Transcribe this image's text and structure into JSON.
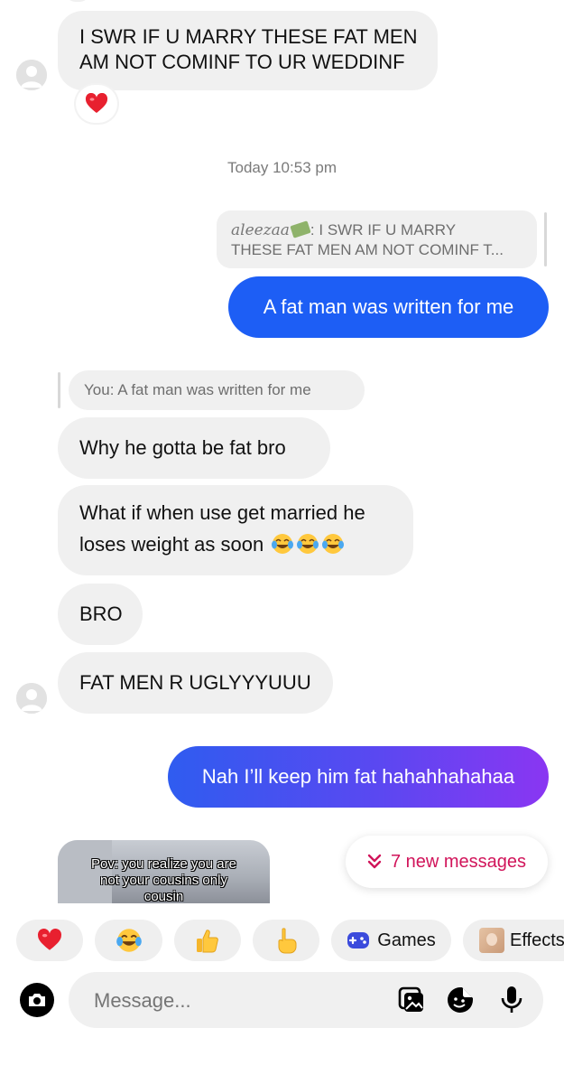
{
  "thread": {
    "msg_swear_line1": "I SWR IF U MARRY THESE FAT MEN",
    "msg_swear_line2": "AM NOT COMINF TO UR WEDDINF",
    "timestamp": "Today 10:53 pm",
    "reply1_username": "aleezaa",
    "reply1_rest": ": I SWR IF U MARRY",
    "reply1_line2": "THESE FAT MEN AM NOT COMINF T...",
    "out_msg1": "A fat man was written for me",
    "reply2_quote": "You: A fat man was written for me",
    "msg_why": "Why he gotta be fat bro",
    "msg_whatif_line1": "What if when use get married he",
    "msg_whatif_line2": "loses weight as soon ",
    "msg_bro": "BRO",
    "msg_fatmen": "FAT MEN R UGLYYYUUU",
    "out_msg2": "Nah I’ll keep him fat hahahhahahaa",
    "media_caption_line1": "Pov: you realize you are",
    "media_caption_line2": "not your cousins only",
    "media_caption_line3": "cousin"
  },
  "new_messages": {
    "label": "7 new messages"
  },
  "quick_reactions": {
    "games_label": "Games",
    "effects_label": "Effects"
  },
  "composer": {
    "placeholder": "Message..."
  },
  "colors": {
    "outgoing_bubble": "#1c5ff6",
    "outgoing_gradient_start": "#2f5cf0",
    "outgoing_gradient_end": "#8a36f2",
    "new_messages_text": "#d1145a",
    "incoming_bubble": "#f0f0f0",
    "background": "#ffffff"
  },
  "icons": {
    "reaction": "red-heart",
    "emoji_tears": "face-with-tears-of-joy",
    "avatar": "default-profile-avatar",
    "chips": [
      "red-heart",
      "face-with-tears-of-joy",
      "thumbs-up",
      "pointing-hand",
      "game-controller",
      "effects-thumbnail"
    ],
    "composer": [
      "camera",
      "gallery",
      "sticker",
      "microphone"
    ]
  }
}
